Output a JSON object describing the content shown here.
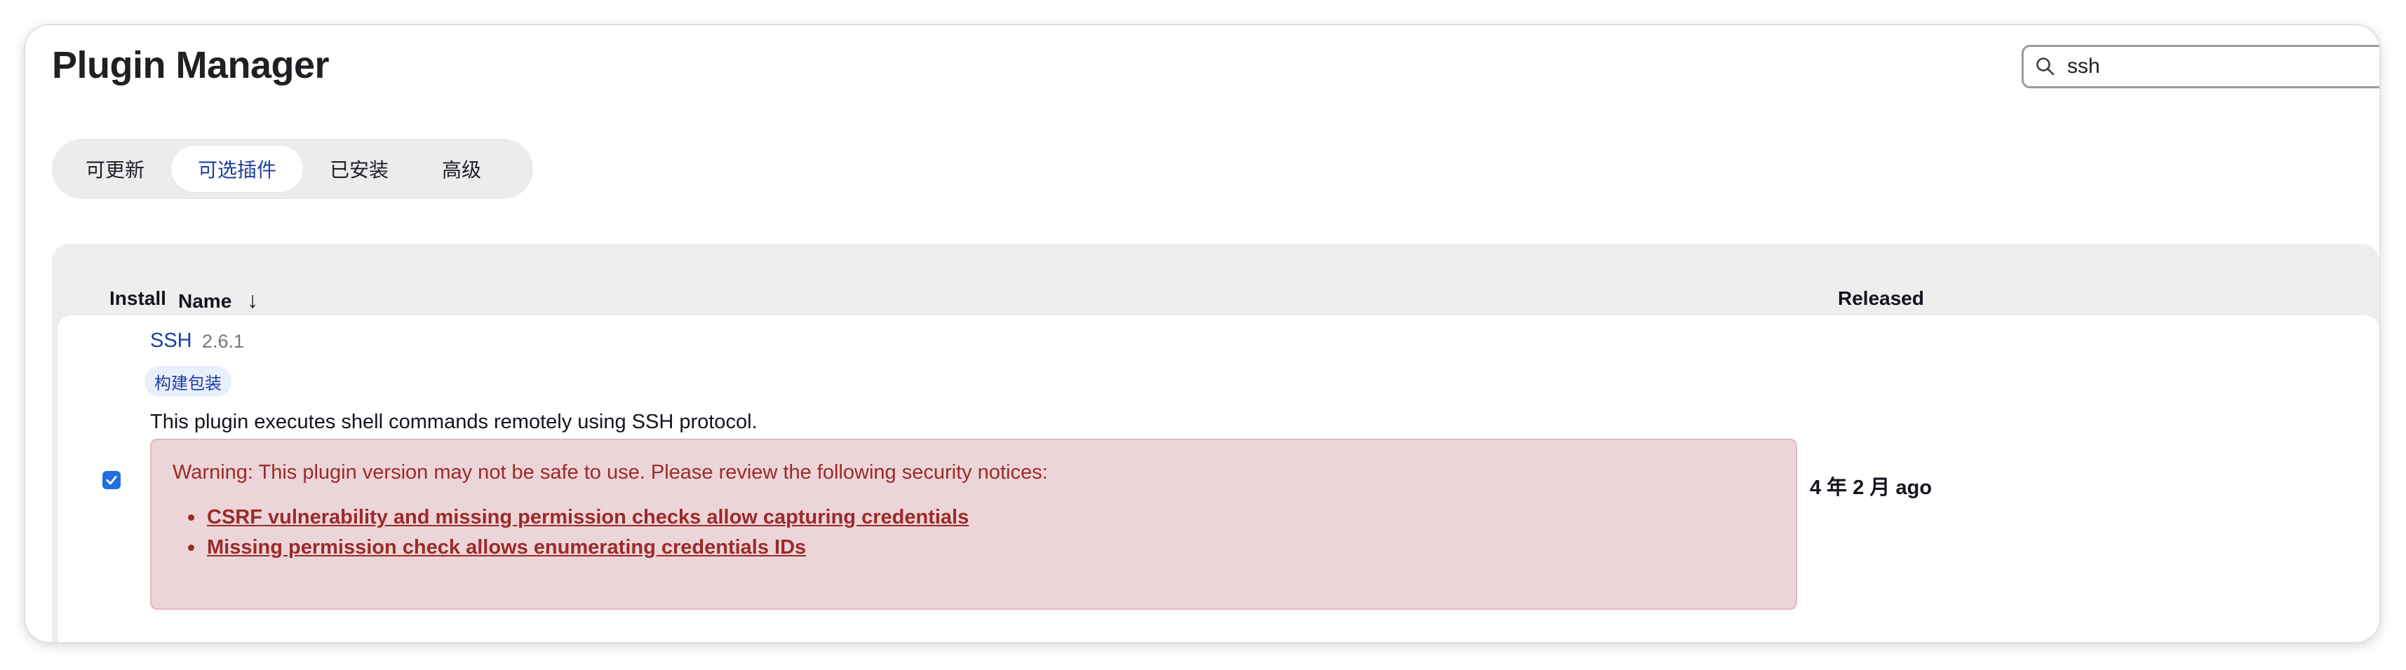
{
  "header": {
    "title": "Plugin Manager"
  },
  "search": {
    "value": "ssh",
    "icon": "search-icon"
  },
  "tabs": [
    {
      "label": "可更新",
      "active": false
    },
    {
      "label": "可选插件",
      "active": true
    },
    {
      "label": "已安装",
      "active": false
    },
    {
      "label": "高级",
      "active": false
    }
  ],
  "table": {
    "columns": {
      "install": "Install",
      "name": "Name",
      "sort_indicator": "↓",
      "released": "Released"
    },
    "rows": [
      {
        "installed_checked": true,
        "name": "SSH",
        "version": "2.6.1",
        "tag": "构建包装",
        "description": "This plugin executes shell commands remotely using SSH protocol.",
        "warning": {
          "text": "Warning: This plugin version may not be safe to use. Please review the following security notices:",
          "notices": [
            "CSRF vulnerability and missing permission checks allow capturing credentials",
            "Missing permission check allows enumerating credentials IDs"
          ]
        },
        "released": "4 年 2 月 ago"
      }
    ]
  },
  "colors": {
    "accent": "#1e3ea8",
    "warning_bg": "#ecd5d8",
    "warning_text": "#9c2a2a",
    "checkbox": "#1f6fe0"
  }
}
